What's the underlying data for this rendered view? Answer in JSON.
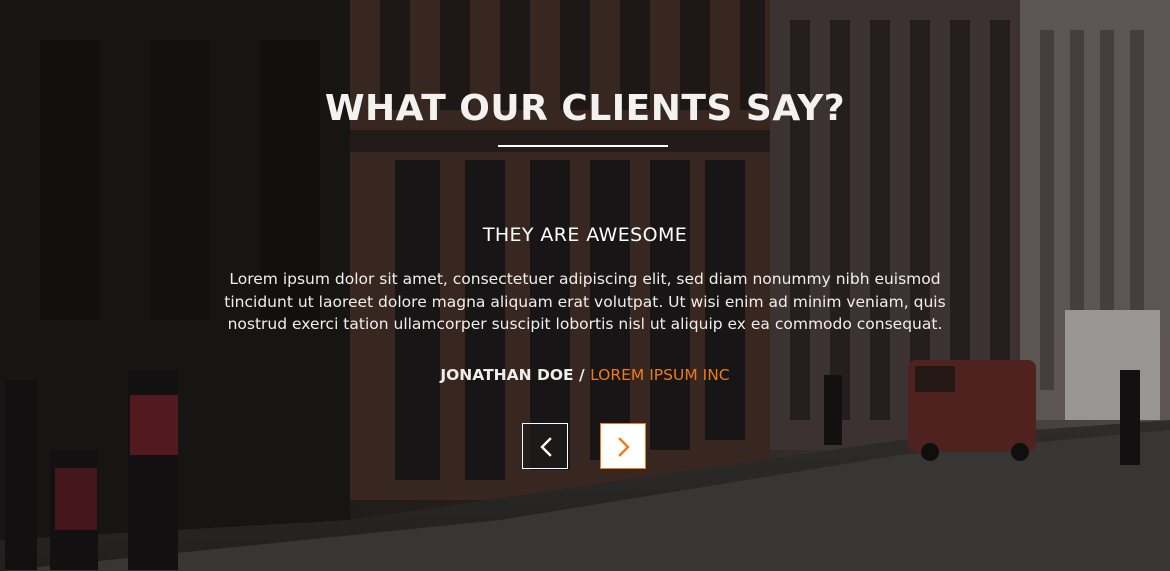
{
  "testimonials": {
    "title": "WHAT OUR CLIENTS SAY?",
    "quote_heading": "THEY ARE AWESOME",
    "quote_text": "Lorem ipsum dolor sit amet, consectetuer adipiscing elit, sed diam nonummy nibh euismod tincidunt ut laoreet dolore magna aliquam erat volutpat. Ut wisi enim ad minim veniam, quis nostrud exerci tation ullamcorper suscipit lobortis nisl ut aliquip ex ea commodo consequat.",
    "author_name": "JONATHAN DOE",
    "author_separator": " / ",
    "author_company": "LOREM IPSUM INC",
    "accent_color": "#f07a1a"
  },
  "controls": {
    "prev_icon": "chevron-left-icon",
    "next_icon": "chevron-right-icon"
  },
  "background": {
    "description_icon": "street-photo"
  }
}
